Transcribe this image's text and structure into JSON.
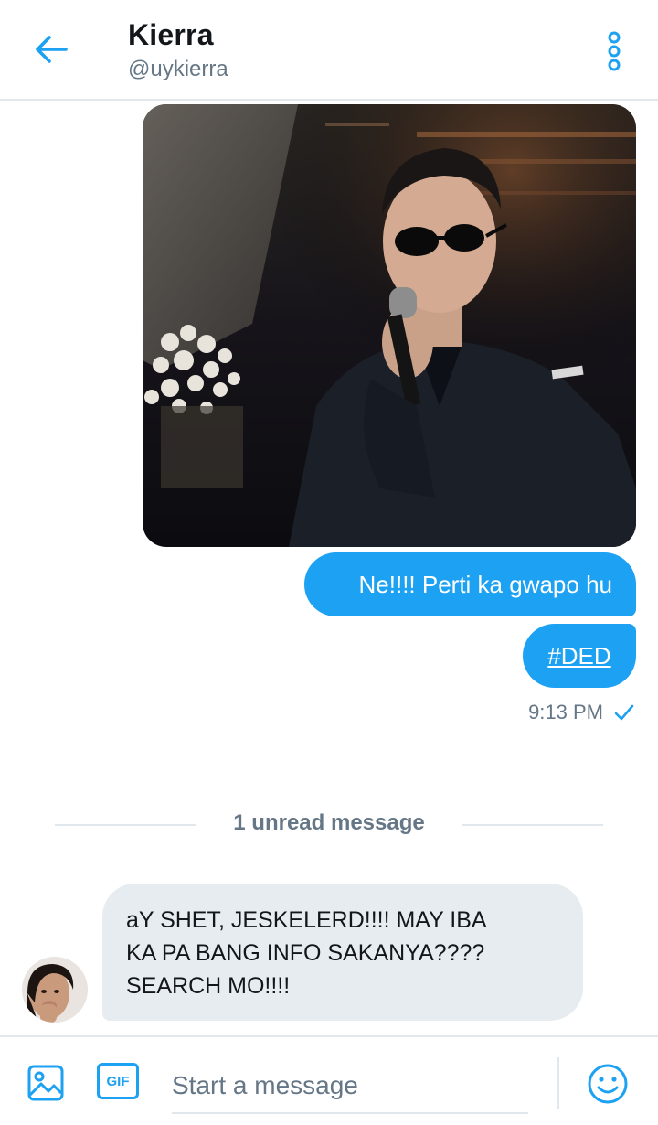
{
  "header": {
    "title": "Kierra",
    "handle": "@uykierra",
    "back_icon": "arrow-left-icon",
    "more_icon": "more-vertical-icon"
  },
  "thread": {
    "outgoing": [
      {
        "text": "Ne!!!! Perti ka gwapo hu"
      },
      {
        "hashtag": "#DED"
      }
    ],
    "sent_time": "9:13 PM",
    "read_receipt_icon": "checkmark-icon",
    "unread_divider": "1 unread message",
    "incoming": {
      "lines": [
        "aY SHET, JESKELERD!!!! MAY IBA",
        "KA PA BANG INFO SAKANYA????",
        "SEARCH MO!!!!"
      ]
    }
  },
  "composer": {
    "placeholder": "Start a message",
    "gif_label": "GIF",
    "media_icon": "image-icon",
    "emoji_icon": "smiley-icon"
  },
  "colors": {
    "accent": "#1da1f2",
    "incoming_bubble": "#e6ecf0",
    "secondary_text": "#657786",
    "divider": "#e1e8ed"
  }
}
